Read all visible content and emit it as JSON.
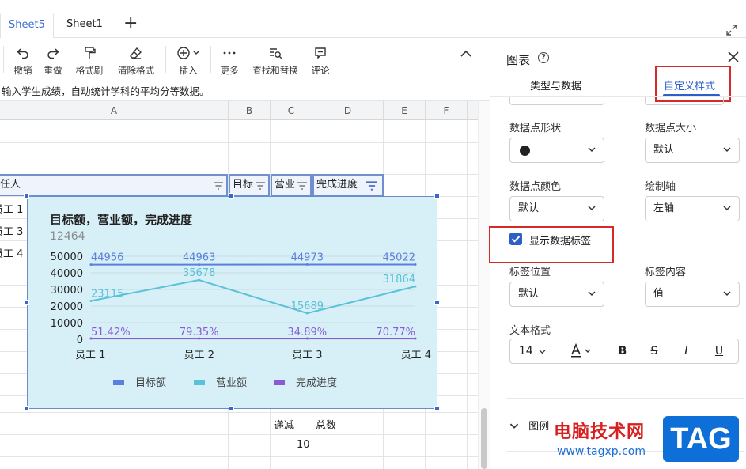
{
  "tabs": [
    {
      "label": "Sheet5",
      "active": true
    },
    {
      "label": "Sheet1",
      "active": false
    }
  ],
  "toolbar": {
    "items": [
      {
        "label": "撤销",
        "icon": "undo-icon"
      },
      {
        "label": "重做",
        "icon": "redo-icon"
      },
      {
        "label": "格式刷",
        "icon": "format-painter-icon"
      },
      {
        "label": "清除格式",
        "icon": "eraser-icon"
      },
      {
        "label": "插入",
        "icon": "plus-circle-icon"
      },
      {
        "label": "更多",
        "icon": "more-icon"
      },
      {
        "label": "查找和替换",
        "icon": "find-replace-icon"
      },
      {
        "label": "评论",
        "icon": "comment-icon"
      }
    ]
  },
  "description": "输入学生成绩，自动统计学科的平均分等数据。",
  "grid": {
    "columns": [
      "A",
      "B",
      "C",
      "D",
      "E",
      "F"
    ],
    "header_cells": [
      "责任人",
      "目标",
      "营业",
      "完成进度"
    ],
    "left_cells": [
      "员工 1",
      "员工 3",
      "员工 4"
    ],
    "bottom_cells": {
      "c": "递减",
      "d": "总数",
      "c_value": "10"
    }
  },
  "chart_data": {
    "type": "line",
    "title": "目标额，营业额，完成进度",
    "subtitle": "12464",
    "categories": [
      "员工 1",
      "员工 2",
      "员工 3",
      "员工 4"
    ],
    "ylim": [
      0,
      50000
    ],
    "yticks": [
      "0",
      "10000",
      "20000",
      "30000",
      "40000",
      "50000"
    ],
    "series": [
      {
        "name": "目标额",
        "values": [
          44956,
          44963,
          44973,
          45022
        ],
        "labels": [
          "44956",
          "44963",
          "44973",
          "45022"
        ],
        "color": "#5b7fdc"
      },
      {
        "name": "营业额",
        "values": [
          23115,
          35678,
          15689,
          31864
        ],
        "labels": [
          "23115",
          "35678",
          "15689",
          "31864"
        ],
        "color": "#5bc0d8"
      },
      {
        "name": "完成进度",
        "values": [
          0.5142,
          0.7935,
          0.3489,
          0.7077
        ],
        "labels": [
          "51.42%",
          "79.35%",
          "34.89%",
          "70.77%"
        ],
        "color": "#8b5bd6"
      }
    ],
    "legend": "bottom",
    "grid": true
  },
  "panel": {
    "title": "图表",
    "tabs": [
      "类型与数据",
      "自定义样式"
    ],
    "active_tab": "自定义样式",
    "point_shape_label": "数据点形状",
    "point_size_label": "数据点大小",
    "point_size_value": "默认",
    "point_color_label": "数据点颜色",
    "point_color_value": "默认",
    "axis_label": "绘制轴",
    "axis_value": "左轴",
    "show_labels": "显示数据标签",
    "label_pos_label": "标签位置",
    "label_pos_value": "默认",
    "label_content_label": "标签内容",
    "label_content_value": "值",
    "text_format_label": "文本格式",
    "font_size": "14",
    "legend_label": "图例"
  },
  "watermark": {
    "site_name": "电脑技术网",
    "url": "www.tagxp.com",
    "logo": "TAG"
  }
}
